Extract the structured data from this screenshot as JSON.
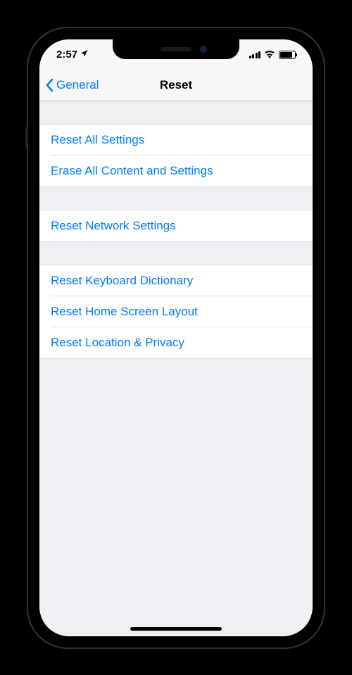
{
  "status_bar": {
    "time": "2:57"
  },
  "nav": {
    "back_label": "General",
    "title": "Reset"
  },
  "groups": [
    {
      "items": [
        {
          "label": "Reset All Settings"
        },
        {
          "label": "Erase All Content and Settings"
        }
      ]
    },
    {
      "items": [
        {
          "label": "Reset Network Settings"
        }
      ]
    },
    {
      "items": [
        {
          "label": "Reset Keyboard Dictionary"
        },
        {
          "label": "Reset Home Screen Layout"
        },
        {
          "label": "Reset Location & Privacy"
        }
      ]
    }
  ],
  "colors": {
    "accent": "#007aff",
    "background": "#efeff4",
    "cell_background": "#ffffff"
  }
}
